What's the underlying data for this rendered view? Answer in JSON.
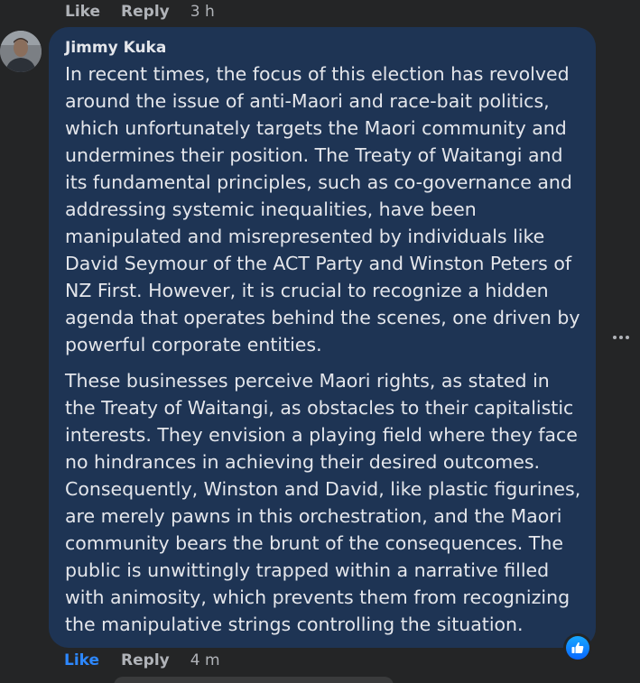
{
  "top_actions": {
    "like_label": "Like",
    "reply_label": "Reply",
    "time": "3 h"
  },
  "comment": {
    "author": "Jimmy Kuka",
    "paragraphs": [
      "In recent times, the focus of this election has revolved around the issue of anti-Maori and race-bait politics, which unfortunately targets the Maori community and undermines their position. The Treaty of Waitangi and its fundamental principles, such as co-governance and addressing systemic inequalities, have been manipulated and misrepresented by individuals like David Seymour of the ACT Party and Winston Peters of NZ First. However, it is crucial to recognize a hidden agenda that operates behind the scenes, one driven by powerful corporate entities.",
      "These businesses perceive Maori rights, as stated in the Treaty of Waitangi, as obstacles to their capitalistic interests. They envision a playing field where they face no hindrances in achieving their desired outcomes. Consequently, Winston and David, like plastic figurines, are merely pawns in this orchestration, and the Maori community bears the brunt of the consequences. The public is unwittingly trapped within a narrative filled with animosity, which prevents them from recognizing the manipulative strings controlling the situation."
    ],
    "actions": {
      "like_label": "Like",
      "reply_label": "Reply",
      "time": "4 m"
    }
  },
  "icons": {
    "more": "more-options-icon",
    "reaction": "thumbs-up-icon"
  },
  "colors": {
    "background": "#242526",
    "bubble": "#1e3454",
    "liked_accent": "#2d88ff"
  }
}
